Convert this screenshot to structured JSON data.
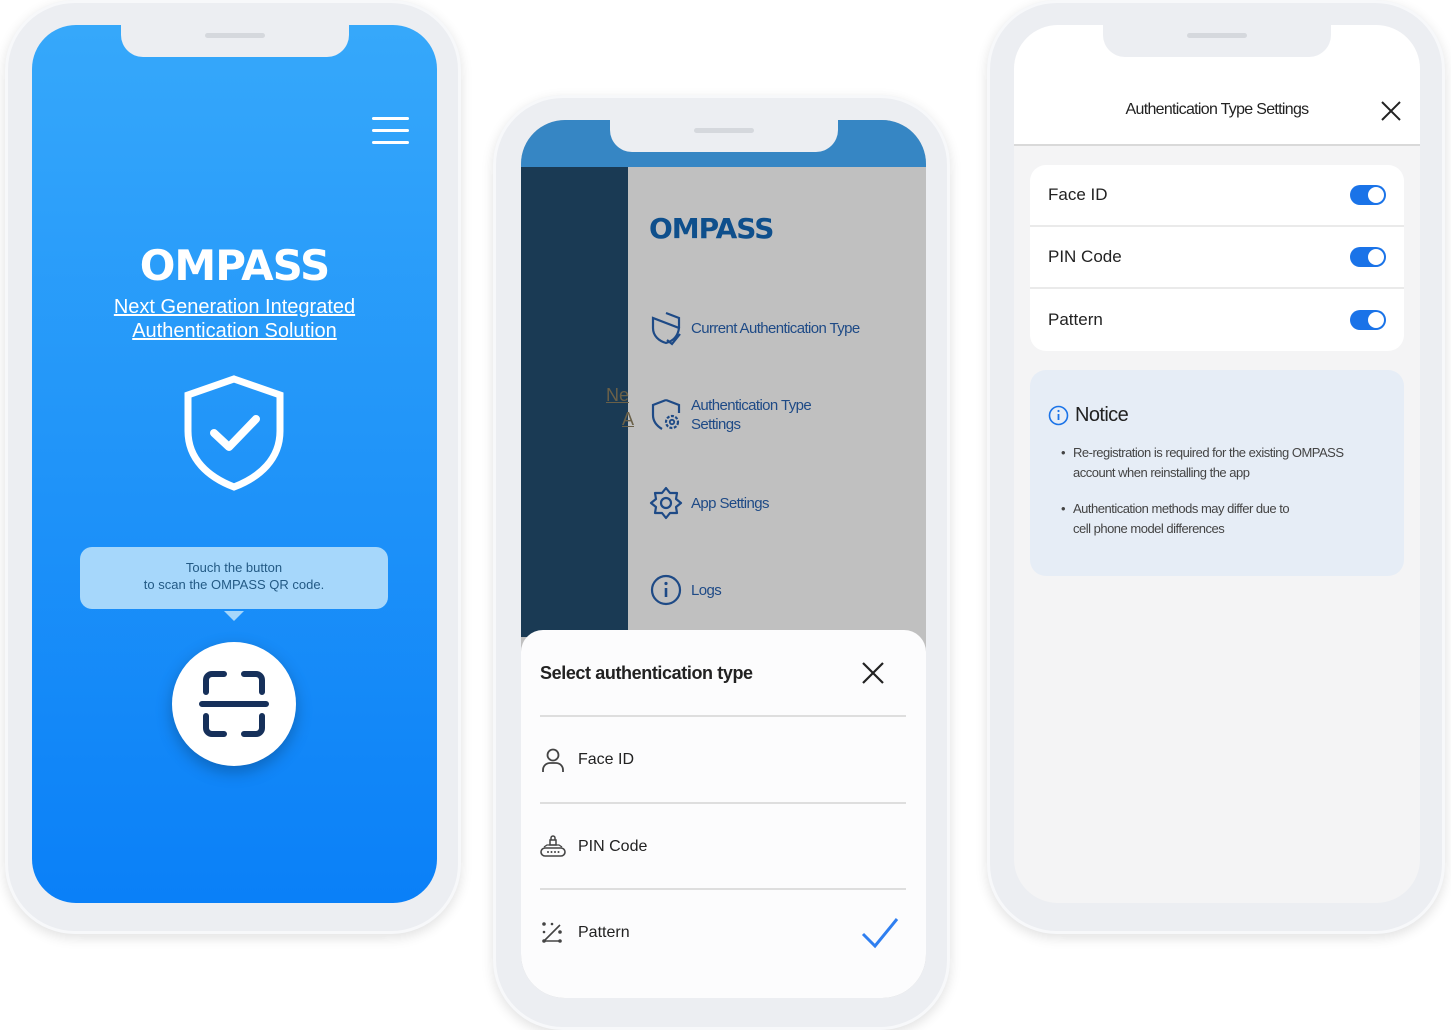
{
  "home": {
    "logo": "OMPASS",
    "subtitle_line1": "Next Generation Integrated",
    "subtitle_line2": "Authentication Solution",
    "tooltip_line1": "Touch the button",
    "tooltip_line2": "to scan the OMPASS QR code.",
    "menu_icon": "hamburger-icon",
    "scan_icon": "qr-scan-icon",
    "brand_color": "#0a80f8"
  },
  "drawer": {
    "logo": "OMPASS",
    "peek_text_1": "Ne",
    "peek_text_2": "A",
    "items": [
      {
        "label": "Current Authentication Type",
        "icon": "shield-check-icon"
      },
      {
        "label_line1": "Authentication Type",
        "label_line2": "Settings",
        "icon": "shield-gear-icon"
      },
      {
        "label": "App Settings",
        "icon": "gear-icon"
      },
      {
        "label": "Logs",
        "icon": "info-icon"
      }
    ]
  },
  "sheet": {
    "title": "Select authentication type",
    "options": [
      {
        "label": "Face ID",
        "icon": "person-icon"
      },
      {
        "label": "PIN Code",
        "icon": "pin-keypad-icon"
      },
      {
        "label": "Pattern",
        "icon": "pattern-icon",
        "selected": true
      }
    ],
    "check_color": "#2f7ff0"
  },
  "settings": {
    "title": "Authentication Type Settings",
    "toggles": [
      {
        "label": "Face ID",
        "on": true
      },
      {
        "label": "PIN Code",
        "on": true
      },
      {
        "label": "Pattern",
        "on": true
      }
    ],
    "notice_title": "Notice",
    "notices": [
      {
        "line1": "Re-registration is required for the existing OMPASS",
        "line2": "account when reinstalling the app"
      },
      {
        "line1": "Authentication methods may differ due to",
        "line2": "cell phone model differences"
      }
    ],
    "toggle_color": "#1a73e8"
  }
}
